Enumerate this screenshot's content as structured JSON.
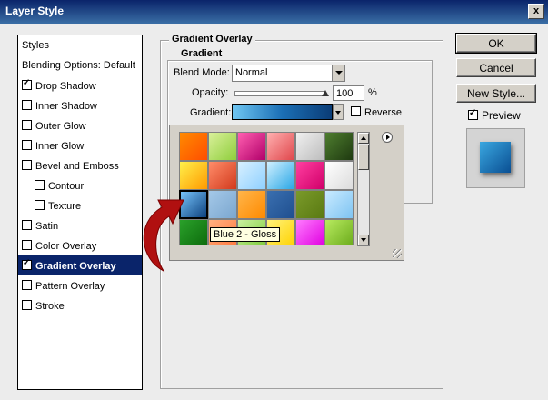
{
  "window": {
    "title": "Layer Style",
    "close_label": "x"
  },
  "styles_list": {
    "items": [
      {
        "label": "Styles",
        "checkbox": false,
        "checked": false,
        "selected": false,
        "indent": false
      },
      {
        "label": "Blending Options: Default",
        "checkbox": false,
        "checked": false,
        "selected": false,
        "indent": false
      },
      {
        "label": "Drop Shadow",
        "checkbox": true,
        "checked": true,
        "selected": false,
        "indent": false
      },
      {
        "label": "Inner Shadow",
        "checkbox": true,
        "checked": false,
        "selected": false,
        "indent": false
      },
      {
        "label": "Outer Glow",
        "checkbox": true,
        "checked": false,
        "selected": false,
        "indent": false
      },
      {
        "label": "Inner Glow",
        "checkbox": true,
        "checked": false,
        "selected": false,
        "indent": false
      },
      {
        "label": "Bevel and Emboss",
        "checkbox": true,
        "checked": false,
        "selected": false,
        "indent": false
      },
      {
        "label": "Contour",
        "checkbox": true,
        "checked": false,
        "selected": false,
        "indent": true
      },
      {
        "label": "Texture",
        "checkbox": true,
        "checked": false,
        "selected": false,
        "indent": true
      },
      {
        "label": "Satin",
        "checkbox": true,
        "checked": false,
        "selected": false,
        "indent": false
      },
      {
        "label": "Color Overlay",
        "checkbox": true,
        "checked": false,
        "selected": false,
        "indent": false
      },
      {
        "label": "Gradient Overlay",
        "checkbox": true,
        "checked": true,
        "selected": true,
        "indent": false
      },
      {
        "label": "Pattern Overlay",
        "checkbox": true,
        "checked": false,
        "selected": false,
        "indent": false
      },
      {
        "label": "Stroke",
        "checkbox": true,
        "checked": false,
        "selected": false,
        "indent": false
      }
    ]
  },
  "gradient_overlay": {
    "title": "Gradient Overlay",
    "gradient_group": "Gradient",
    "blend_mode_label": "Blend Mode:",
    "blend_mode_value": "Normal",
    "opacity_label": "Opacity:",
    "opacity_value": "100",
    "opacity_unit": "%",
    "opacity_fraction": 1.0,
    "gradient_label": "Gradient:",
    "reverse_label": "Reverse"
  },
  "gradient_picker": {
    "tooltip": "Blue 2 - Gloss",
    "menu_icon": "flyout-menu-icon",
    "swatches": [
      [
        "linear-gradient(135deg,#ff8a00,#ff4e00)",
        "linear-gradient(135deg,#d9f09a,#8fce3c)",
        "linear-gradient(135deg,#ff5fb0,#b1006a)",
        "linear-gradient(135deg,#ffb0b0,#e0474c)",
        "linear-gradient(135deg,#f0f0f0,#bdbdbd)",
        "linear-gradient(135deg,#4e7d2f,#1f3a10)"
      ],
      [
        "linear-gradient(135deg,#fff04a,#ff9a00)",
        "linear-gradient(135deg,#ff8c69,#d23a1d)",
        "linear-gradient(135deg,#d8f0ff,#8fd0ff)",
        "linear-gradient(135deg,#cfefff,#2aa7e6)",
        "linear-gradient(135deg,#ff3fa0,#d1006a)",
        "linear-gradient(135deg,#ffffff,#dcdcdc)"
      ],
      [
        "linear-gradient(135deg,#79c7ff,#0a3d7a)",
        "linear-gradient(135deg,#a4c8e8,#7ba7cf)",
        "linear-gradient(135deg,#ffb54a,#ff8a00)",
        "linear-gradient(135deg,#3a6fb0,#1f4f8f)",
        "linear-gradient(135deg,#7a9a2a,#5a7a12)",
        "linear-gradient(135deg,#c8eaff,#7fc4f2)"
      ],
      [
        "linear-gradient(135deg,#2aa02a,#0c6a0c)",
        "linear-gradient(135deg,#ffb080,#ff7a40)",
        "linear-gradient(135deg,#c9f0a0,#7ecb3a)",
        "linear-gradient(135deg,#fff27a,#ffd200)",
        "linear-gradient(135deg,#ff7aff,#e000e0)",
        "linear-gradient(135deg,#b7ea5f,#6aaa1a)"
      ]
    ],
    "selected_row": 2,
    "selected_col": 0
  },
  "buttons": {
    "ok": "OK",
    "cancel": "Cancel",
    "new_style": "New Style...",
    "preview_label": "Preview"
  }
}
